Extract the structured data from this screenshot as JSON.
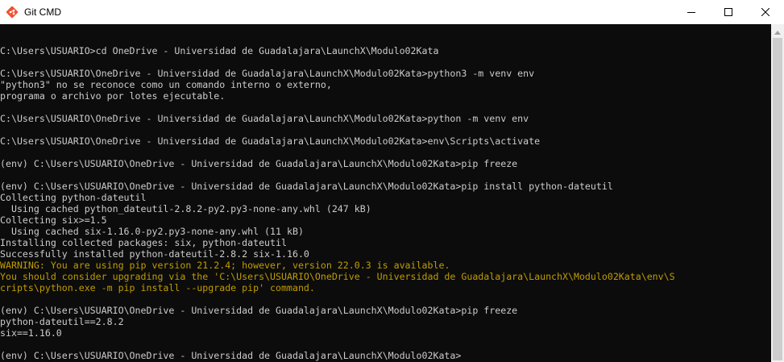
{
  "window": {
    "title": "Git CMD",
    "icon": "git-diamond-icon",
    "accent": "#f05133"
  },
  "controls": {
    "minimize_icon": "minimize-icon",
    "maximize_icon": "maximize-icon",
    "close_icon": "close-icon"
  },
  "colors": {
    "background": "#0c0c0c",
    "text": "#cccccc",
    "warning": "#c19c00"
  },
  "console": {
    "lines": [
      {
        "text": "",
        "kind": "normal"
      },
      {
        "text": "C:\\Users\\USUARIO>cd OneDrive - Universidad de Guadalajara\\LaunchX\\Modulo02Kata",
        "kind": "normal"
      },
      {
        "text": "",
        "kind": "normal"
      },
      {
        "text": "C:\\Users\\USUARIO\\OneDrive - Universidad de Guadalajara\\LaunchX\\Modulo02Kata>python3 -m venv env",
        "kind": "normal"
      },
      {
        "text": "\"python3\" no se reconoce como un comando interno o externo,",
        "kind": "normal"
      },
      {
        "text": "programa o archivo por lotes ejecutable.",
        "kind": "normal"
      },
      {
        "text": "",
        "kind": "normal"
      },
      {
        "text": "C:\\Users\\USUARIO\\OneDrive - Universidad de Guadalajara\\LaunchX\\Modulo02Kata>python -m venv env",
        "kind": "normal"
      },
      {
        "text": "",
        "kind": "normal"
      },
      {
        "text": "C:\\Users\\USUARIO\\OneDrive - Universidad de Guadalajara\\LaunchX\\Modulo02Kata>env\\Scripts\\activate",
        "kind": "normal"
      },
      {
        "text": "",
        "kind": "normal"
      },
      {
        "text": "(env) C:\\Users\\USUARIO\\OneDrive - Universidad de Guadalajara\\LaunchX\\Modulo02Kata>pip freeze",
        "kind": "normal"
      },
      {
        "text": "",
        "kind": "normal"
      },
      {
        "text": "(env) C:\\Users\\USUARIO\\OneDrive - Universidad de Guadalajara\\LaunchX\\Modulo02Kata>pip install python-dateutil",
        "kind": "normal"
      },
      {
        "text": "Collecting python-dateutil",
        "kind": "normal"
      },
      {
        "text": "  Using cached python_dateutil-2.8.2-py2.py3-none-any.whl (247 kB)",
        "kind": "normal"
      },
      {
        "text": "Collecting six>=1.5",
        "kind": "normal"
      },
      {
        "text": "  Using cached six-1.16.0-py2.py3-none-any.whl (11 kB)",
        "kind": "normal"
      },
      {
        "text": "Installing collected packages: six, python-dateutil",
        "kind": "normal"
      },
      {
        "text": "Successfully installed python-dateutil-2.8.2 six-1.16.0",
        "kind": "normal"
      },
      {
        "text": "WARNING: You are using pip version 21.2.4; however, version 22.0.3 is available.",
        "kind": "warn"
      },
      {
        "text": "You should consider upgrading via the 'C:\\Users\\USUARIO\\OneDrive - Universidad de Guadalajara\\LaunchX\\Modulo02Kata\\env\\S",
        "kind": "warn"
      },
      {
        "text": "cripts\\python.exe -m pip install --upgrade pip' command.",
        "kind": "warn"
      },
      {
        "text": "",
        "kind": "normal"
      },
      {
        "text": "(env) C:\\Users\\USUARIO\\OneDrive - Universidad de Guadalajara\\LaunchX\\Modulo02Kata>pip freeze",
        "kind": "normal"
      },
      {
        "text": "python-dateutil==2.8.2",
        "kind": "normal"
      },
      {
        "text": "six==1.16.0",
        "kind": "normal"
      },
      {
        "text": "",
        "kind": "normal"
      },
      {
        "text": "(env) C:\\Users\\USUARIO\\OneDrive - Universidad de Guadalajara\\LaunchX\\Modulo02Kata>",
        "kind": "normal"
      }
    ]
  }
}
